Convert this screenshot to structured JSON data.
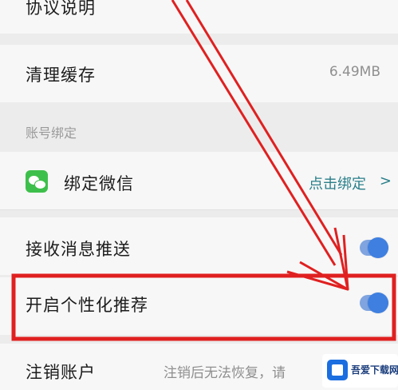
{
  "rows": {
    "agreement": {
      "label": "协议说明"
    },
    "clear_cache": {
      "label": "清理缓存",
      "value": "6.49MB"
    },
    "section_account": {
      "title": "账号绑定"
    },
    "wechat": {
      "label": "绑定微信",
      "action": "点击绑定",
      "chevron": ">"
    },
    "push": {
      "label": "接收消息推送",
      "toggle_on": true
    },
    "personalized": {
      "label": "开启个性化推荐",
      "toggle_on": true
    },
    "cancel_account": {
      "label": "注销账户",
      "hint": "注销后无法恢复，请"
    }
  },
  "watermark": {
    "text": "吾爱下载网"
  },
  "colors": {
    "arrow": "#e02020",
    "toggle": "#3e7fe0",
    "wechat": "#3dc04b"
  }
}
